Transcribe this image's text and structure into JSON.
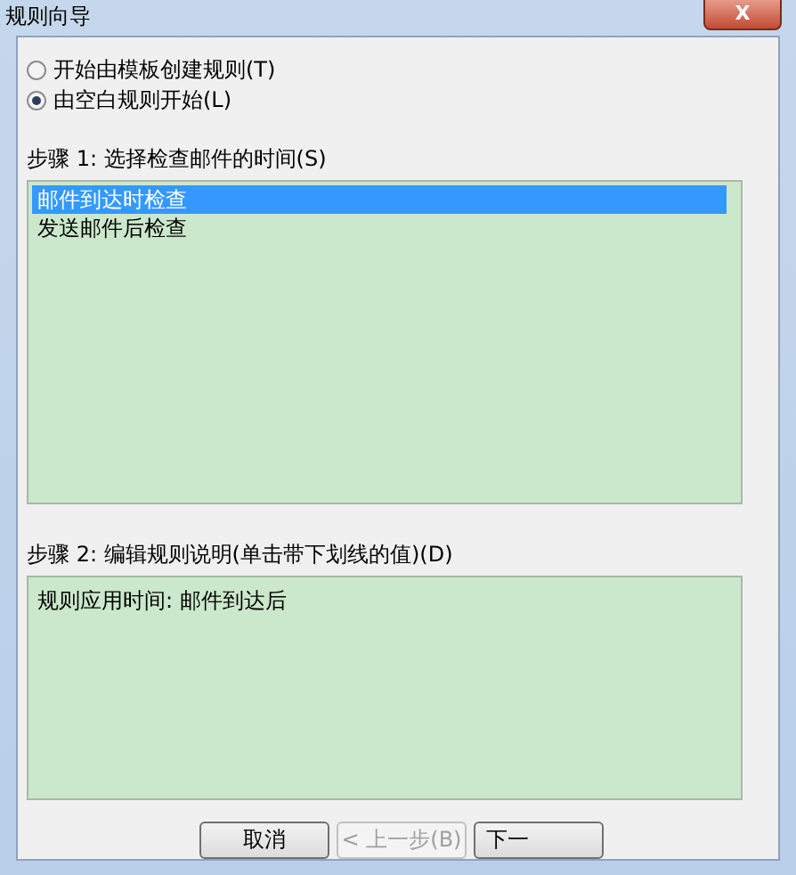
{
  "window": {
    "title": "规则向导",
    "close": "X"
  },
  "options": [
    {
      "label": "开始由模板创建规则(T)",
      "selected": false
    },
    {
      "label": "由空白规则开始(L)",
      "selected": true
    }
  ],
  "step1": {
    "label": "步骤 1: 选择检查邮件的时间(S)",
    "items": [
      {
        "label": "邮件到达时检查",
        "selected": true
      },
      {
        "label": "发送邮件后检查",
        "selected": false
      }
    ]
  },
  "step2": {
    "label": "步骤 2: 编辑规则说明(单击带下划线的值)(D)",
    "text": "规则应用时间: 邮件到达后"
  },
  "buttons": [
    {
      "label": "取消",
      "disabled": false
    },
    {
      "label": "< 上一步(B)",
      "disabled": true
    },
    {
      "label": "下一",
      "disabled": false
    }
  ]
}
